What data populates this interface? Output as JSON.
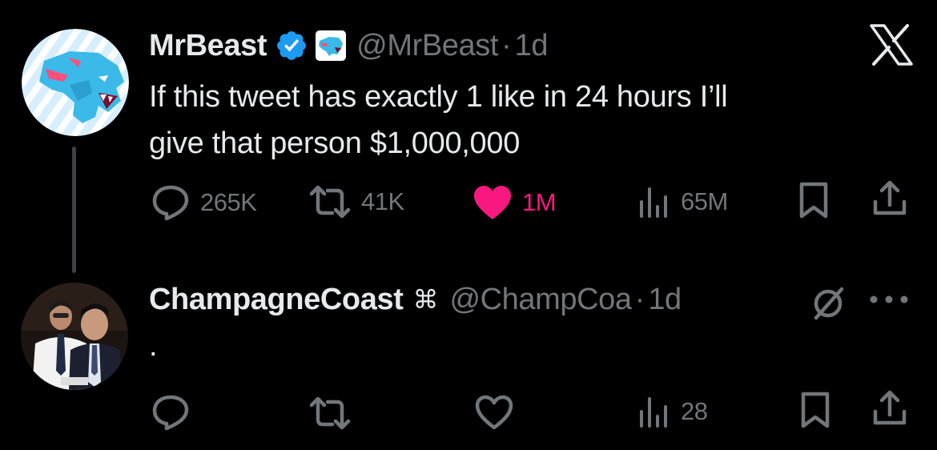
{
  "tweet": {
    "author_name": "MrBeast",
    "author_handle": "@MrBeast",
    "separator": "·",
    "age": "1d",
    "text_line1": "If this tweet has exactly 1 like in 24 hours I’ll",
    "text_line2": "give that person $1,000,000",
    "stats": {
      "replies": "265K",
      "retweets": "41K",
      "likes": "1M",
      "views": "65M"
    },
    "liked": true
  },
  "reply": {
    "author_name": "ChampagneCoast",
    "name_symbol": "⌘",
    "author_handle": "@ChampCoa",
    "separator": "·",
    "age": "1d",
    "text": ".",
    "stats": {
      "views": "28"
    }
  },
  "icons": {
    "top_right": "x-logo-icon",
    "reply_top_right": [
      "muted-icon",
      "more-icon"
    ],
    "actions": [
      "reply-icon",
      "retweet-icon",
      "like-icon",
      "views-icon",
      "bookmark-icon",
      "share-icon"
    ]
  },
  "colors": {
    "background": "#000000",
    "text": "#e7e9ea",
    "secondary_text": "#71767b",
    "like_active": "#f91880",
    "verified": "#1d9bf0",
    "avatar1_bg": "#cfe9ff"
  }
}
